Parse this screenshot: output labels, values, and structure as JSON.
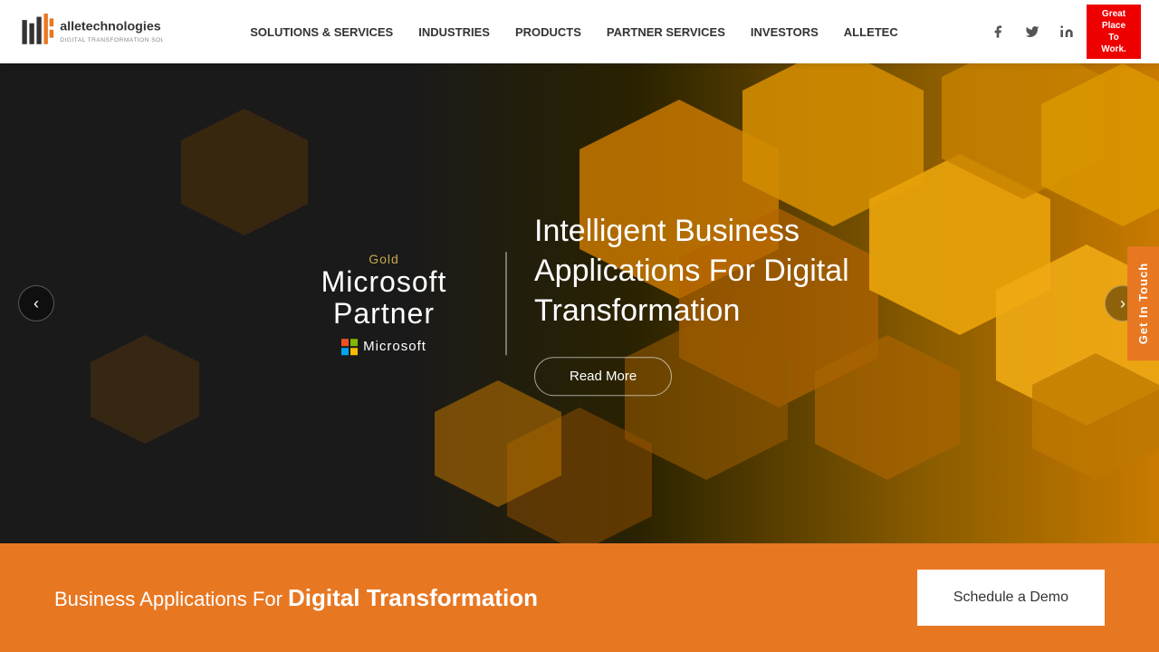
{
  "header": {
    "logo_alt": "Alle Technologies - Digital Transformation Solutions",
    "tagline": "DIGITAL TRANSFORMATION SOLUTIONS",
    "nav": [
      {
        "label": "SOLUTIONS & SERVICES",
        "id": "solutions-services"
      },
      {
        "label": "INDUSTRIES",
        "id": "industries"
      },
      {
        "label": "PRODUCTS",
        "id": "products"
      },
      {
        "label": "PARTNER SERVICES",
        "id": "partner-services"
      },
      {
        "label": "INVESTORS",
        "id": "investors"
      },
      {
        "label": "ALLETEC",
        "id": "alletec"
      }
    ],
    "social": [
      {
        "label": "Facebook",
        "icon": "f"
      },
      {
        "label": "Twitter",
        "icon": "t"
      },
      {
        "label": "LinkedIn",
        "icon": "in"
      }
    ],
    "gpw_badge": {
      "line1": "Great",
      "line2": "Place",
      "line3": "To",
      "line4": "Work."
    }
  },
  "hero": {
    "ms_partner": {
      "gold_label": "Gold",
      "partner_label": "Microsoft Partner",
      "ms_label": "Microsoft"
    },
    "tagline": "Intelligent Business Applications For Digital Transformation",
    "read_more_label": "Read More",
    "prev_label": "‹",
    "next_label": "›",
    "get_in_touch_label": "Get In Touch"
  },
  "bottom_bar": {
    "text_normal": "Business Applications For ",
    "text_bold": "Digital Transformation",
    "schedule_btn_label": "Schedule a Demo"
  }
}
